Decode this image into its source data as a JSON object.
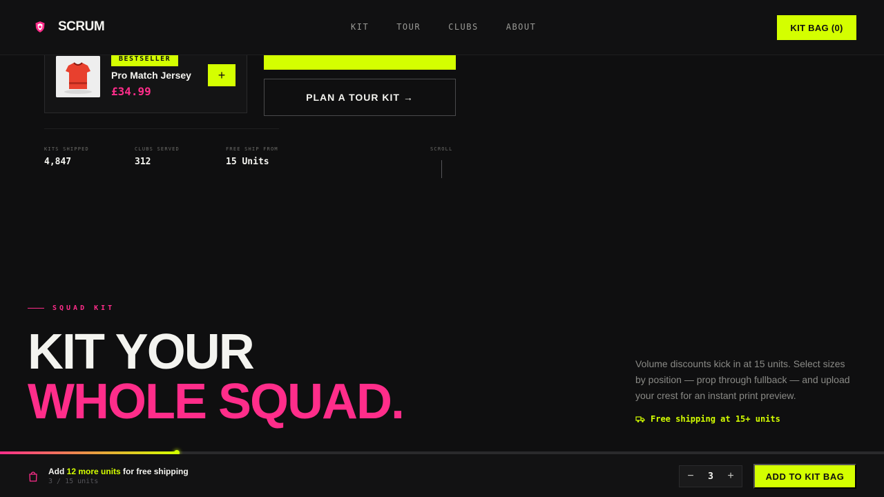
{
  "brand": {
    "name": "SCRUM",
    "logo_icon": "shield-crest-icon"
  },
  "nav": {
    "items": [
      {
        "label": "KIT"
      },
      {
        "label": "TOUR"
      },
      {
        "label": "CLUBS"
      },
      {
        "label": "ABOUT"
      }
    ]
  },
  "header": {
    "kit_bag_label": "KIT BAG (0)"
  },
  "product": {
    "badge": "BESTSELLER",
    "name": "Pro Match Jersey",
    "price": "£34.99",
    "image_icon": "red-jersey-image",
    "add_label": "+"
  },
  "cta": {
    "tour_label": "PLAN A TOUR KIT →"
  },
  "stats": [
    {
      "label": "KITS SHIPPED",
      "value": "4,847"
    },
    {
      "label": "CLUBS SERVED",
      "value": "312"
    },
    {
      "label": "FREE SHIP FROM",
      "value": "15 Units"
    }
  ],
  "scroll_label": "SCROLL",
  "squad": {
    "eyebrow": "SQUAD KIT",
    "headline_line1": "KIT YOUR",
    "headline_line2": "WHOLE SQUAD.",
    "description": "Volume discounts kick in at 15 units. Select sizes by position — prop through fullback — and upload your crest for an instant print preview.",
    "free_shipping": "Free shipping at 15+ units",
    "shipping_icon": "truck-icon"
  },
  "shipping_bar": {
    "msg_prefix": "Add ",
    "msg_highlight": "12 more units",
    "msg_suffix": " for free shipping",
    "count": "3 / 15 units",
    "progress": 0.2,
    "bag_icon": "shopping-bag-icon"
  },
  "quantity": {
    "minus": "−",
    "value": "3",
    "plus": "+"
  },
  "add_to_bag_label": "ADD TO KIT BAG",
  "colors": {
    "accent": "#d4ff00",
    "pink": "#ff2d8a",
    "background": "#0f0f10"
  }
}
